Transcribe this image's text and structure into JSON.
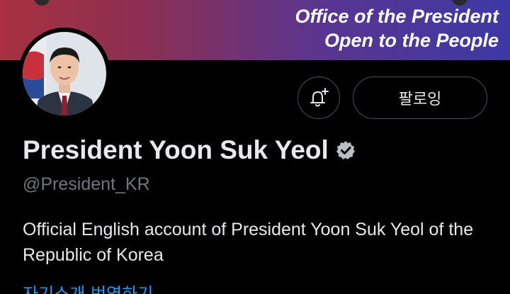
{
  "banner": {
    "line1": "Office of the President",
    "line2": "Open to the People"
  },
  "profile": {
    "display_name": "President Yoon Suk Yeol",
    "handle": "@President_KR",
    "bio": "Official English account of President Yoon Suk Yeol of the Republic of Korea",
    "verified": true
  },
  "actions": {
    "follow_label": "팔로잉",
    "notification_icon": "bell-plus-icon"
  },
  "bio_translate_label": "자기소개 번역하기",
  "colors": {
    "background": "#000000",
    "text_primary": "#e7e9ea",
    "text_secondary": "#71767b",
    "link": "#1d9bf0",
    "button_border": "#4a4f55"
  }
}
